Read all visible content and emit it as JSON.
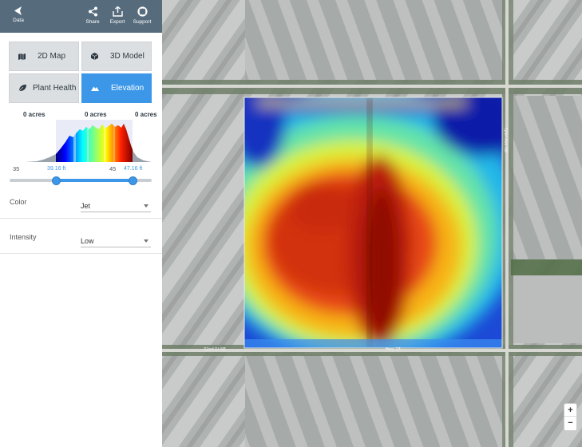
{
  "topbar": {
    "back_label": "Data",
    "share_label": "Share",
    "export_label": "Export",
    "support_label": "Support"
  },
  "tabs": [
    {
      "label": "2D Map",
      "icon": "map-icon",
      "active": false
    },
    {
      "label": "3D Model",
      "icon": "cube-icon",
      "active": false
    },
    {
      "label": "Plant Health",
      "icon": "leaf-icon",
      "active": false
    },
    {
      "label": "Elevation",
      "icon": "mountain-icon",
      "active": true
    }
  ],
  "histogram": {
    "acres_left": "0 acres",
    "acres_mid": "0 acres",
    "acres_right": "0 acres",
    "tick_min": "35",
    "tick_max": "45",
    "range_low": "39.16 ft",
    "range_high": "47.16 ft",
    "slider_low_fraction": 0.33,
    "slider_high_fraction": 0.88
  },
  "controls": {
    "color_label": "Color",
    "color_value": "Jet",
    "intensity_label": "Intensity",
    "intensity_value": "Low"
  },
  "map": {
    "road_west": "32nd St NE",
    "road_east": "Tyler Ave NE",
    "road_south": "Hwy 23",
    "zoom_in": "+",
    "zoom_out": "−"
  },
  "colors": {
    "topbar": "#566b7c",
    "accent": "#3c97e8"
  }
}
